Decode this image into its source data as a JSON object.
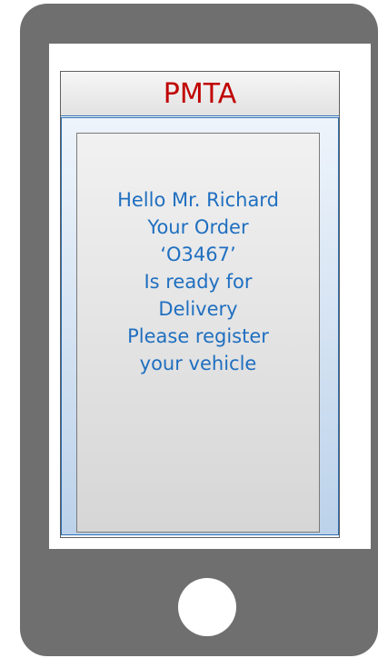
{
  "app": {
    "title": "PMTA"
  },
  "message": {
    "lines": [
      "Hello Mr. Richard",
      "Your Order",
      "‘O3467’",
      "Is ready for",
      "Delivery",
      "Please register",
      "your vehicle"
    ]
  },
  "colors": {
    "title_text": "#c00000",
    "message_text": "#1f6fc0",
    "phone_body": "#6f6f6f",
    "accent_border": "#2d6fb3"
  },
  "icons": {
    "home_button": "home-button-circle"
  }
}
